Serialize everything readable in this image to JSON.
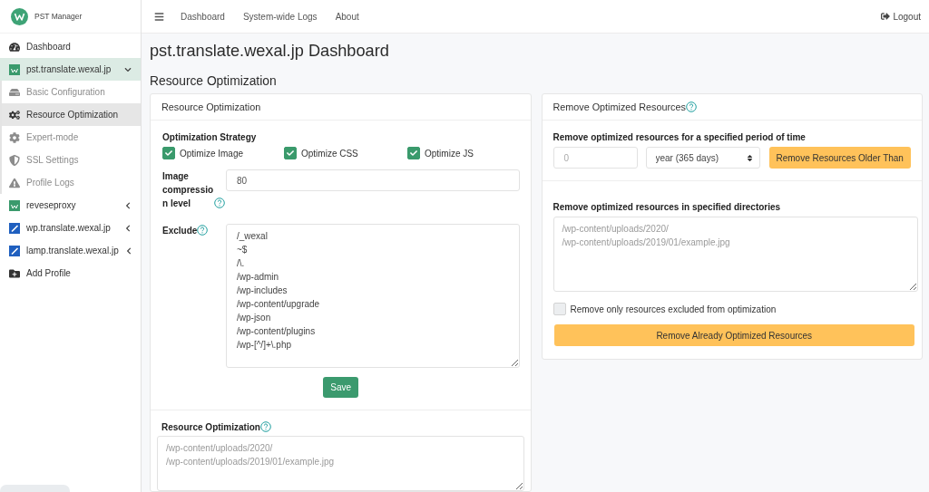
{
  "sidebar": {
    "brand": "PST Manager",
    "items": [
      {
        "kind": "link",
        "label": "Dashboard"
      },
      {
        "kind": "profile",
        "label": "pst.translate.wexal.jp",
        "expanded": true,
        "children": [
          {
            "label": "Basic Configuration",
            "selected": false
          },
          {
            "label": "Resource Optimization",
            "selected": true
          },
          {
            "label": "Expert-mode",
            "selected": false
          },
          {
            "label": "SSL Settings",
            "selected": false
          },
          {
            "label": "Profile Logs",
            "selected": false
          }
        ]
      },
      {
        "kind": "profile",
        "label": "reveseproxy",
        "expanded": false
      },
      {
        "kind": "profile",
        "label": "wp.translate.wexal.jp",
        "expanded": false
      },
      {
        "kind": "profile",
        "label": "lamp.translate.wexal.jp",
        "expanded": false
      },
      {
        "kind": "link",
        "label": "Add Profile"
      }
    ]
  },
  "navbar": {
    "links": [
      "Dashboard",
      "System-wide Logs",
      "About"
    ],
    "logout": "Logout"
  },
  "page": {
    "title": "pst.translate.wexal.jp Dashboard",
    "subtitle": "Resource Optimization"
  },
  "optimization_card": {
    "title": "Resource Optimization",
    "strategy": {
      "label": "Optimization Strategy",
      "options": [
        {
          "label": "Optimize Image",
          "checked": true
        },
        {
          "label": "Optimize CSS",
          "checked": true
        },
        {
          "label": "Optimize JS",
          "checked": true
        }
      ]
    },
    "compression": {
      "label": "Image compression level",
      "value": "80"
    },
    "exclude": {
      "label": "Exclude",
      "lines": [
        "/_wexal",
        "~$",
        "/\\.",
        "/wp-admin",
        "/wp-includes",
        "/wp-content/upgrade",
        "/wp-json",
        "/wp-content/plugins",
        "/wp-[^/]+\\.php"
      ]
    },
    "save_button": "Save",
    "paths": {
      "label": "Resource Optimization",
      "placeholder_lines": [
        "/wp-content/uploads/2020/",
        "/wp-content/uploads/2019/01/example.jpg"
      ]
    }
  },
  "remove_card": {
    "title": "Remove Optimized Resources",
    "period": {
      "label": "Remove optimized resources for a specified period of time",
      "amount_placeholder": "0",
      "unit": "year (365 days)",
      "button": "Remove Resources Older Than"
    },
    "directories": {
      "label": "Remove optimized resources in specified directories",
      "placeholder_lines": [
        "/wp-content/uploads/2020/",
        "/wp-content/uploads/2019/01/example.jpg"
      ]
    },
    "only_excluded": {
      "label": "Remove only resources excluded from optimization",
      "checked": false
    },
    "button": "Remove Already Optimized Resources"
  }
}
